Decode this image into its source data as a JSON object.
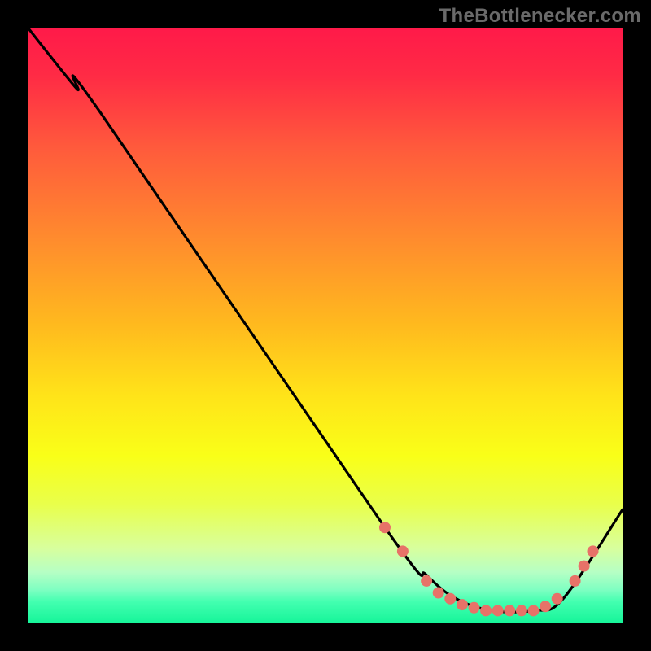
{
  "watermark": "TheBottlenecker.com",
  "chart_data": {
    "type": "line",
    "title": "",
    "xlabel": "",
    "ylabel": "",
    "xlim": [
      0,
      100
    ],
    "ylim": [
      0,
      100
    ],
    "background_gradient": {
      "stops": [
        {
          "offset": 0.0,
          "color": "#ff1a49"
        },
        {
          "offset": 0.08,
          "color": "#ff2b45"
        },
        {
          "offset": 0.2,
          "color": "#ff5a3c"
        },
        {
          "offset": 0.35,
          "color": "#ff8a2e"
        },
        {
          "offset": 0.5,
          "color": "#ffba1e"
        },
        {
          "offset": 0.62,
          "color": "#ffe419"
        },
        {
          "offset": 0.72,
          "color": "#f9ff18"
        },
        {
          "offset": 0.8,
          "color": "#e9ff4a"
        },
        {
          "offset": 0.875,
          "color": "#d8ff9d"
        },
        {
          "offset": 0.915,
          "color": "#b6ffc4"
        },
        {
          "offset": 0.945,
          "color": "#7effc2"
        },
        {
          "offset": 0.965,
          "color": "#43ffb0"
        },
        {
          "offset": 1.0,
          "color": "#17f59a"
        }
      ]
    },
    "series": [
      {
        "name": "bottleneck-curve",
        "color": "#000000",
        "x": [
          0,
          8,
          12,
          60,
          67,
          72,
          78,
          85,
          90,
          100
        ],
        "y": [
          100,
          90,
          86,
          16,
          8,
          4,
          2,
          2,
          4,
          19
        ]
      }
    ],
    "markers": {
      "name": "optimal-range-dots",
      "color": "#e77268",
      "radius": 7,
      "points": [
        {
          "x": 60,
          "y": 16
        },
        {
          "x": 63,
          "y": 12
        },
        {
          "x": 67,
          "y": 7
        },
        {
          "x": 69,
          "y": 5
        },
        {
          "x": 71,
          "y": 4
        },
        {
          "x": 73,
          "y": 3
        },
        {
          "x": 75,
          "y": 2.5
        },
        {
          "x": 77,
          "y": 2
        },
        {
          "x": 79,
          "y": 2
        },
        {
          "x": 81,
          "y": 2
        },
        {
          "x": 83,
          "y": 2
        },
        {
          "x": 85,
          "y": 2
        },
        {
          "x": 87,
          "y": 2.7
        },
        {
          "x": 89,
          "y": 4
        },
        {
          "x": 92,
          "y": 7
        },
        {
          "x": 93.5,
          "y": 9.5
        },
        {
          "x": 95,
          "y": 12
        }
      ]
    }
  }
}
